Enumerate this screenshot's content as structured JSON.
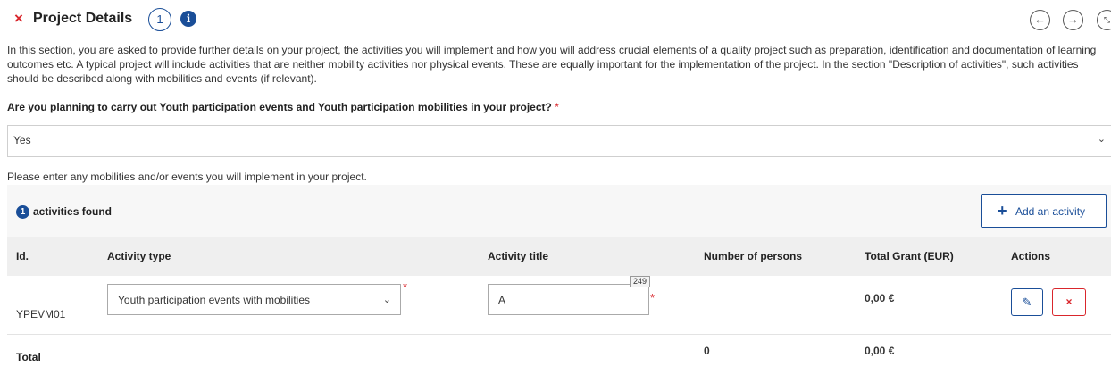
{
  "header": {
    "close_icon": "×",
    "title": "Project Details",
    "step_number": "1",
    "info_icon": "i",
    "nav_prev_icon": "←",
    "nav_next_icon": "→",
    "expand_icon": "⤡"
  },
  "intro_text": "In this section, you are asked to provide further details on your project, the activities you will implement and how you will address crucial elements of a quality project such as preparation, identification and documentation of learning outcomes etc. A typical project will include activities that are neither mobility activities nor physical events. These are equally important for the implementation of the project. In the section \"Description of activities\", such activities should be described along with mobilities and events (if relevant).",
  "question": {
    "label": "Are you planning to carry out Youth participation events and Youth participation mobilities in your project?",
    "required_mark": "*",
    "selected_value": "Yes",
    "chevron_icon": "⌄"
  },
  "hint_text": "Please enter any mobilities and/or events you will implement in your project.",
  "activities": {
    "count_badge": "1",
    "count_text": "activities found",
    "add_button_icon": "+",
    "add_button_label": "Add an activity",
    "columns": [
      "Id.",
      "Activity type",
      "Activity title",
      "Number of persons",
      "Total Grant (EUR)",
      "Actions"
    ],
    "rows": [
      {
        "id": "YPEVM01",
        "activity_type": "Youth participation events with mobilities",
        "activity_title": "A",
        "char_count": "249",
        "number_of_persons": "",
        "total_grant": "0,00 €",
        "edit_icon": "✎",
        "delete_icon": "×"
      }
    ],
    "total": {
      "label": "Total",
      "persons": "0",
      "grant": "0,00 €"
    },
    "required_mark": "*"
  },
  "colors": {
    "accent": "#1a4e98",
    "danger": "#d9262c"
  }
}
